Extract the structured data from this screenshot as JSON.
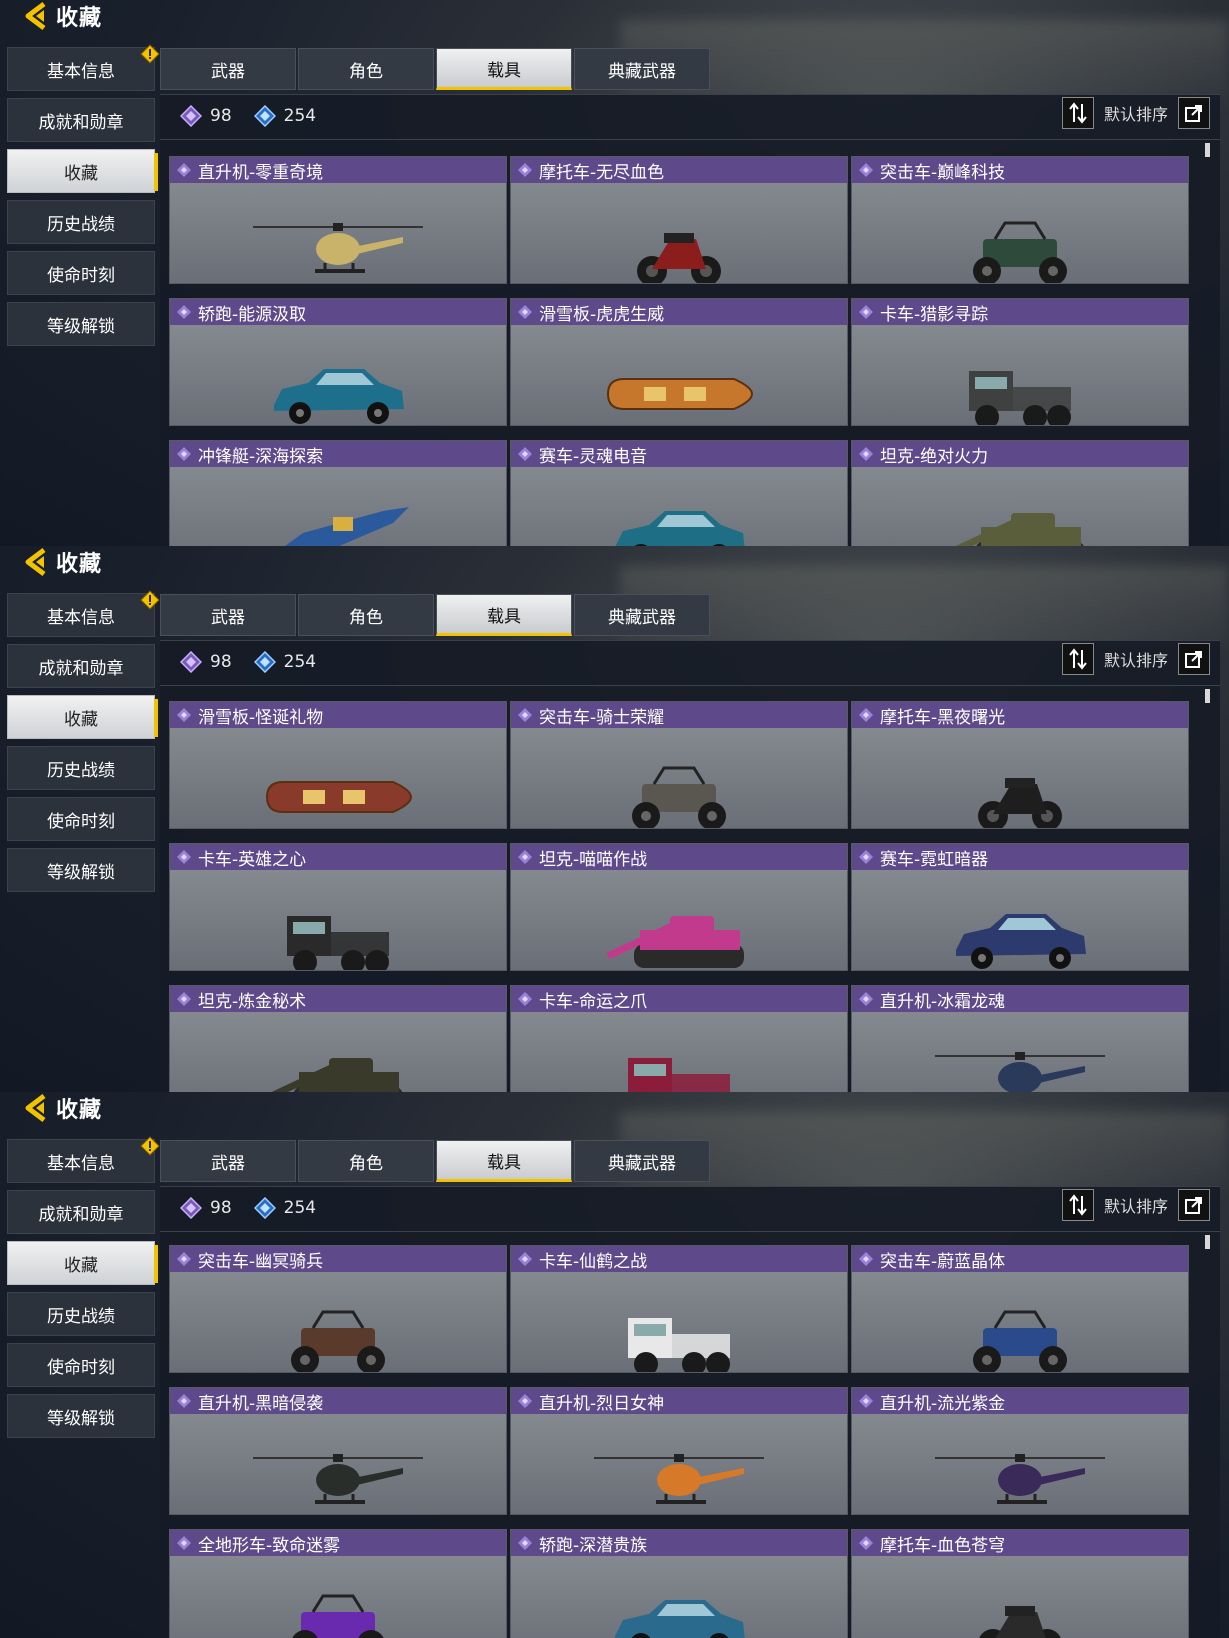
{
  "colors": {
    "accent": "#f2c400",
    "card_title_bg": "#5e4a8a",
    "card_body": "#7f8489"
  },
  "header": {
    "title": "收藏"
  },
  "sidebar": {
    "items": [
      {
        "label": "基本信息",
        "warning": true
      },
      {
        "label": "成就和勋章"
      },
      {
        "label": "收藏",
        "active": true
      },
      {
        "label": "历史战绩"
      },
      {
        "label": "使命时刻"
      },
      {
        "label": "等级解锁"
      }
    ]
  },
  "tabs": [
    {
      "label": "武器"
    },
    {
      "label": "角色"
    },
    {
      "label": "载具",
      "active": true
    },
    {
      "label": "典藏武器"
    }
  ],
  "stats": {
    "purple_count": "98",
    "blue_count": "254"
  },
  "sort": {
    "label": "默认排序"
  },
  "screens": [
    {
      "cards": [
        {
          "title": "直升机-零重奇境",
          "kind": "heli",
          "color": "#c9b26a"
        },
        {
          "title": "摩托车-无尽血色",
          "kind": "moto",
          "color": "#8c1d1d"
        },
        {
          "title": "突击车-巅峰科技",
          "kind": "buggy",
          "color": "#2d4a3a"
        },
        {
          "title": "轿跑-能源汲取",
          "kind": "car",
          "color": "#1d6f8c"
        },
        {
          "title": "滑雪板-虎虎生威",
          "kind": "board",
          "color": "#c7772b"
        },
        {
          "title": "卡车-猎影寻踪",
          "kind": "truck",
          "color": "#3e4140"
        },
        {
          "title": "冲锋艇-深海探索",
          "kind": "boat",
          "color": "#2a5a9c"
        },
        {
          "title": "赛车-灵魂电音",
          "kind": "car",
          "color": "#1e6f86"
        },
        {
          "title": "坦克-绝对火力",
          "kind": "tank",
          "color": "#5b5e3a"
        }
      ]
    },
    {
      "cards": [
        {
          "title": "滑雪板-怪诞礼物",
          "kind": "board",
          "color": "#8a3a2a"
        },
        {
          "title": "突击车-骑士荣耀",
          "kind": "buggy",
          "color": "#5a5650"
        },
        {
          "title": "摩托车-黑夜曙光",
          "kind": "moto",
          "color": "#1e1e1e"
        },
        {
          "title": "卡车-英雄之心",
          "kind": "truck",
          "color": "#2a2a2a"
        },
        {
          "title": "坦克-喵喵作战",
          "kind": "tank",
          "color": "#c23a8c"
        },
        {
          "title": "赛车-霓虹暗器",
          "kind": "car",
          "color": "#2c3a6e"
        },
        {
          "title": "坦克-炼金秘术",
          "kind": "tank",
          "color": "#3a3a2a"
        },
        {
          "title": "卡车-命运之爪",
          "kind": "truck",
          "color": "#8c1d3a"
        },
        {
          "title": "直升机-冰霜龙魂",
          "kind": "heli",
          "color": "#2a3a5a"
        }
      ]
    },
    {
      "cards": [
        {
          "title": "突击车-幽冥骑兵",
          "kind": "buggy",
          "color": "#5a3a2a"
        },
        {
          "title": "卡车-仙鹤之战",
          "kind": "truck",
          "color": "#e8e8e8"
        },
        {
          "title": "突击车-蔚蓝晶体",
          "kind": "buggy",
          "color": "#2a4a8c"
        },
        {
          "title": "直升机-黑暗侵袭",
          "kind": "heli",
          "color": "#2a2e2a"
        },
        {
          "title": "直升机-烈日女神",
          "kind": "heli",
          "color": "#d67a2a"
        },
        {
          "title": "直升机-流光紫金",
          "kind": "heli",
          "color": "#3a2a5a"
        },
        {
          "title": "全地形车-致命迷雾",
          "kind": "buggy",
          "color": "#6a2ab0"
        },
        {
          "title": "轿跑-深潜贵族",
          "kind": "car",
          "color": "#2a6a8c"
        },
        {
          "title": "摩托车-血色苍穹",
          "kind": "moto",
          "color": "#2a2a2a"
        }
      ]
    }
  ]
}
